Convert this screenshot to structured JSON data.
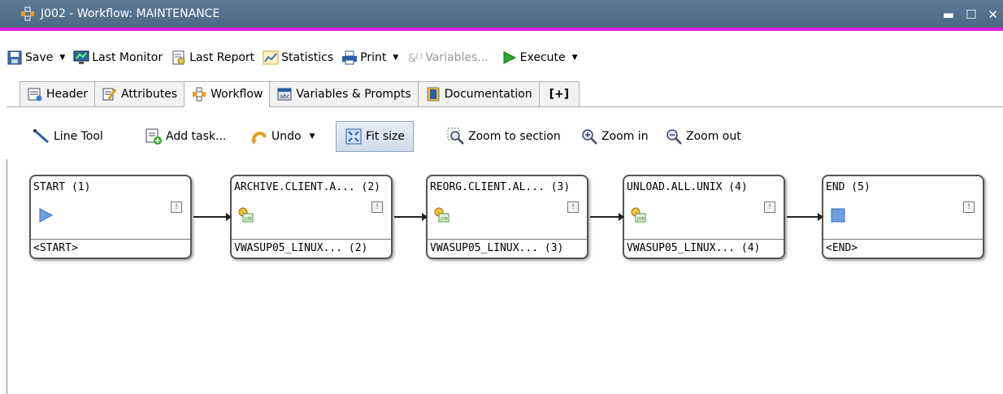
{
  "window": {
    "title": "J002 - Workflow: MAINTENANCE",
    "controls": [
      "minimize-icon",
      "maximize-icon",
      "close-icon"
    ]
  },
  "toolbar": {
    "save_label": "Save",
    "last_monitor_label": "Last Monitor",
    "last_report_label": "Last Report",
    "statistics_label": "Statistics",
    "print_label": "Print",
    "variables_label": "Variables...",
    "execute_label": "Execute"
  },
  "tabs": [
    {
      "label": "Header",
      "icon": "header-icon"
    },
    {
      "label": "Attributes",
      "icon": "attributes-icon"
    },
    {
      "label": "Workflow",
      "icon": "workflow-icon",
      "active": true
    },
    {
      "label": "Variables & Prompts",
      "icon": "variables-prompts-icon"
    },
    {
      "label": "Documentation",
      "icon": "documentation-icon"
    },
    {
      "label": "[+]",
      "icon": "add-tab-icon"
    }
  ],
  "workflow_toolbar": {
    "line_tool_label": "Line Tool",
    "add_task_label": "Add task...",
    "undo_label": "Undo",
    "fit_size_label": "Fit size",
    "zoom_section_label": "Zoom to section",
    "zoom_in_label": "Zoom in",
    "zoom_out_label": "Zoom out"
  },
  "nodes": [
    {
      "title": "START (1)",
      "footer": "<START>",
      "icon": "start-icon"
    },
    {
      "title": "ARCHIVE.CLIENT.A... (2)",
      "footer": "VWASUP05_LINUX... (2)",
      "icon": "job-icon"
    },
    {
      "title": "REORG.CLIENT.AL... (3)",
      "footer": "VWASUP05_LINUX... (3)",
      "icon": "job-icon"
    },
    {
      "title": "UNLOAD.ALL.UNIX (4)",
      "footer": "VWASUP05_LINUX... (4)",
      "icon": "job-icon"
    },
    {
      "title": "END (5)",
      "footer": "<END>",
      "icon": "end-icon"
    }
  ],
  "colors": {
    "titlebar": "#5d7a96",
    "titlebar_accent": "#e020e0",
    "execute_green": "#2aa82a"
  }
}
